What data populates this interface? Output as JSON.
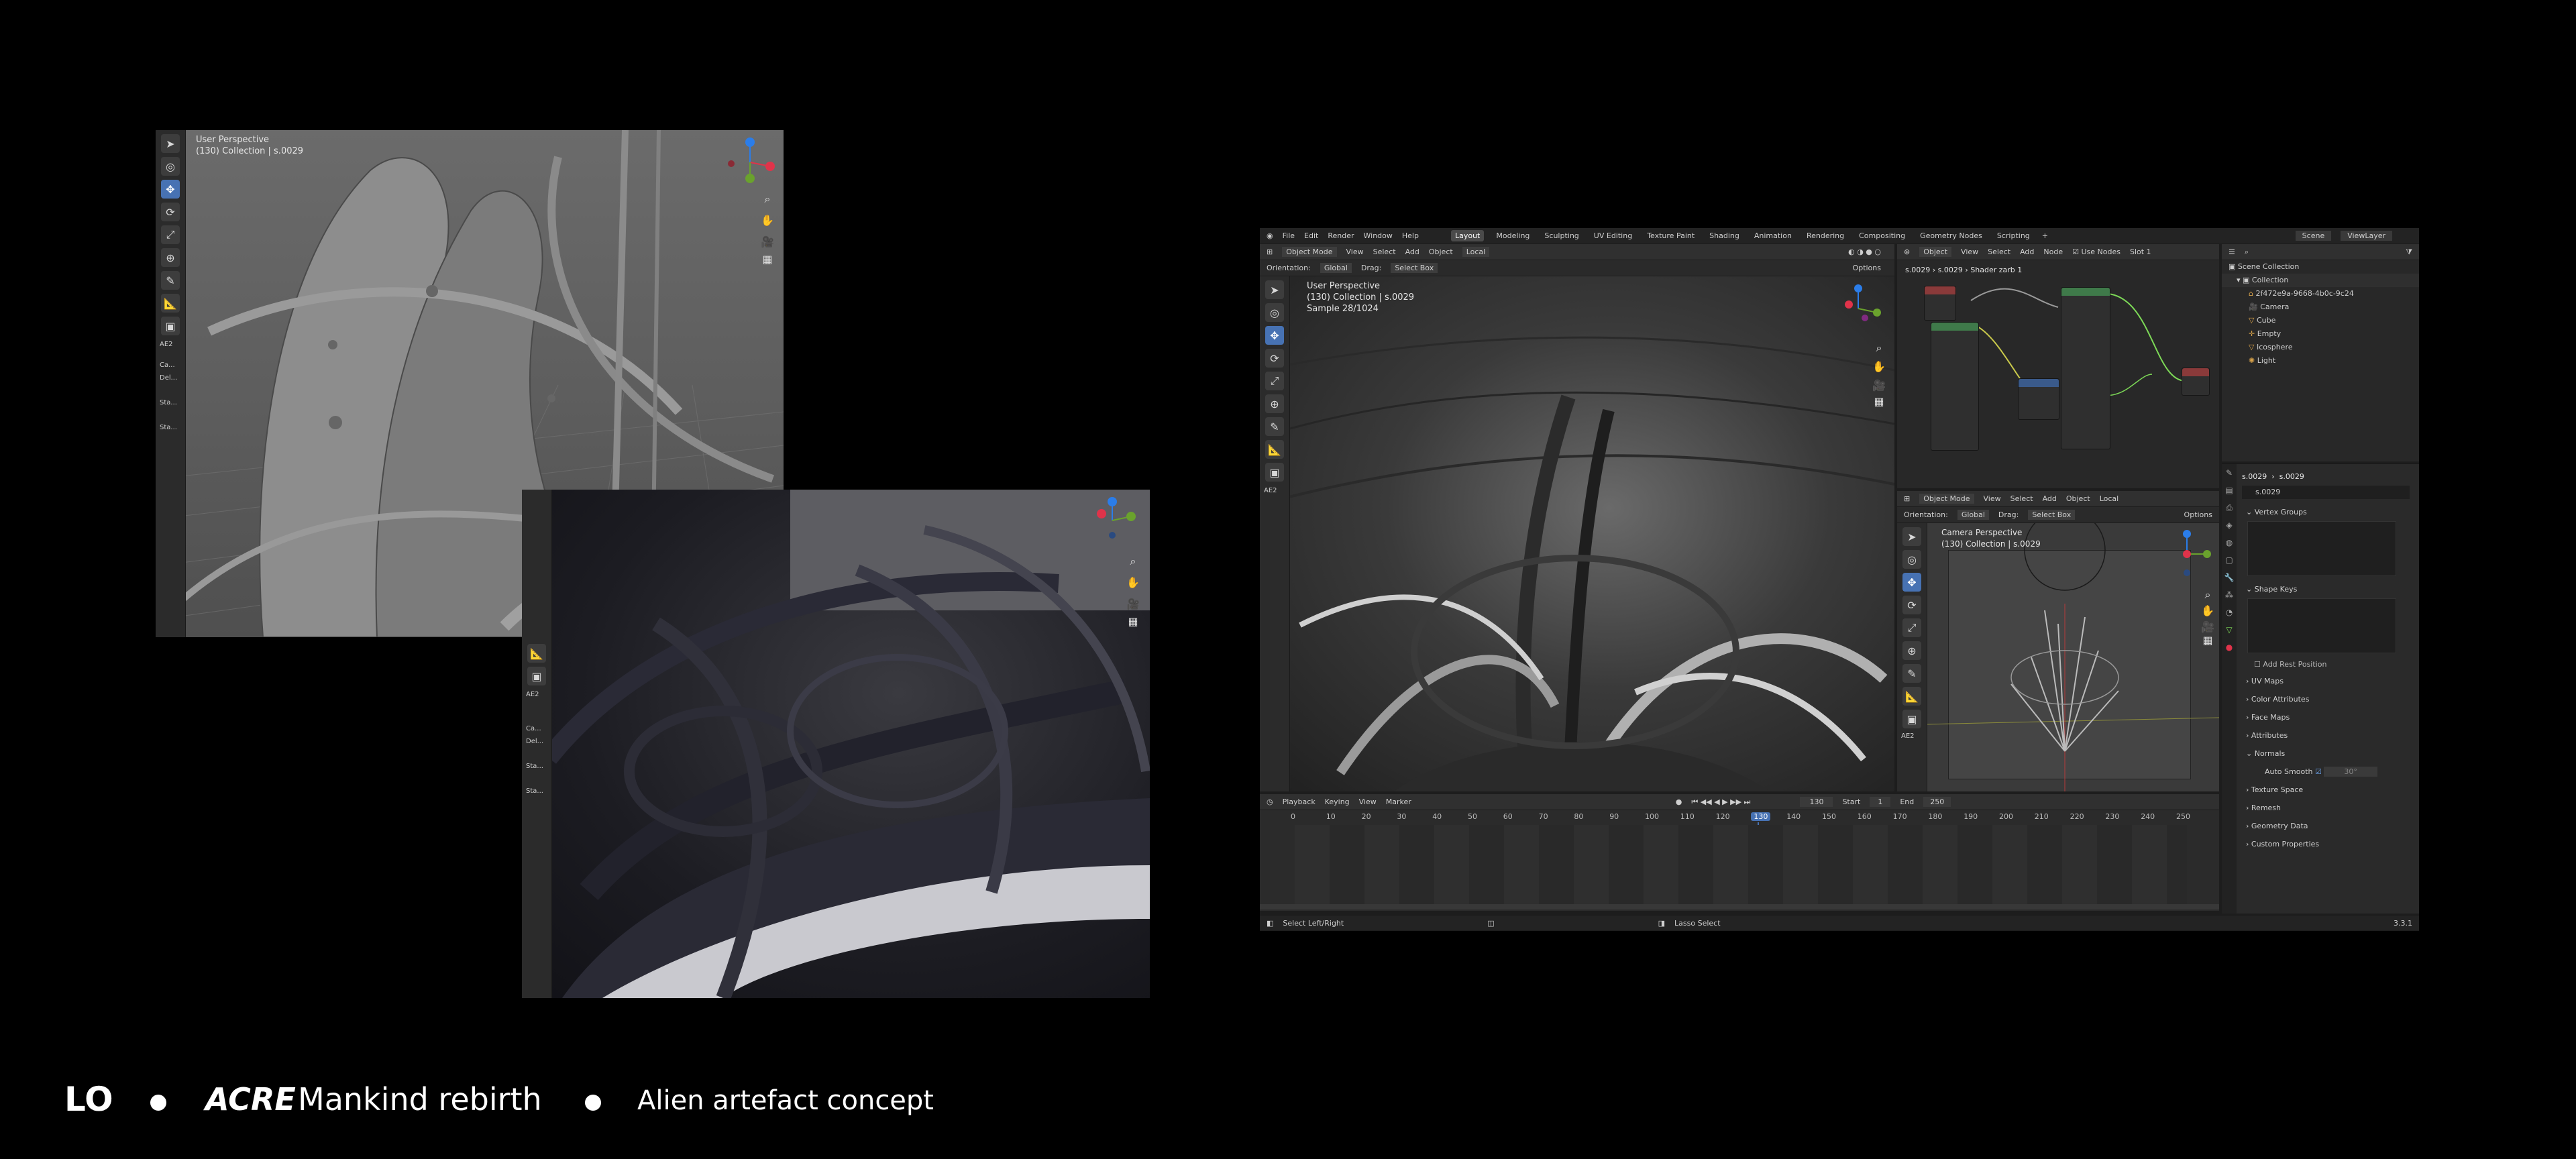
{
  "footer": {
    "logo": "LO",
    "brand": "ACRE",
    "title": "Mankind rebirth",
    "subtitle": "Alien artefact concept"
  },
  "viewport_a": {
    "line1": "User Perspective",
    "line2": "(130) Collection | s.0029",
    "panel_label": "AE2",
    "side_labels": [
      "Ca...",
      "Del...",
      "Sta...",
      "Sta..."
    ]
  },
  "viewport_b": {
    "panel_label": "AE2",
    "side_labels": [
      "Ca...",
      "Del...",
      "Sta...",
      "Sta..."
    ]
  },
  "blender": {
    "menu": [
      "File",
      "Edit",
      "Render",
      "Window",
      "Help"
    ],
    "workspaces": [
      "Layout",
      "Modeling",
      "Sculpting",
      "UV Editing",
      "Texture Paint",
      "Shading",
      "Animation",
      "Rendering",
      "Compositing",
      "Geometry Nodes",
      "Scripting"
    ],
    "active_workspace": "Layout",
    "scene": "Scene",
    "view_layer": "ViewLayer",
    "viewport_header": [
      "Object Mode",
      "View",
      "Select",
      "Add",
      "Object"
    ],
    "orientation_label": "Orientation:",
    "orientation_value": "Global",
    "drag_label": "Drag:",
    "drag_value": "Select Box",
    "pivot_value": "Local",
    "options": "Options",
    "main_vp_line1": "User Perspective",
    "main_vp_line2": "(130) Collection | s.0029",
    "main_vp_line3": "Sample 28/1024",
    "main_panel_label": "AE2",
    "node_header": [
      "Object",
      "View",
      "Select",
      "Add",
      "Node"
    ],
    "use_nodes": "Use Nodes",
    "slot": "Slot 1",
    "breadcrumb": [
      "s.0029",
      "s.0029",
      "Shader zarb 1"
    ],
    "cam_header": [
      "Object Mode",
      "View",
      "Select",
      "Add",
      "Object"
    ],
    "cam_pivot": "Local",
    "cam_orientation_label": "Orientation:",
    "cam_orientation_value": "Global",
    "cam_drag_label": "Drag:",
    "cam_drag_value": "Select Box",
    "cam_options": "Options",
    "cam_line1": "Camera Perspective",
    "cam_line2": "(130) Collection | s.0029",
    "cam_panel_label": "AE2",
    "outliner": {
      "root": "Scene Collection",
      "collection": "Collection",
      "items": [
        "2f472e9a-9668-4b0c-9c24",
        "Camera",
        "Cube",
        "Empty",
        "Icosphere",
        "Light"
      ]
    },
    "properties": {
      "crumb_left": "s.0029",
      "crumb_right": "s.0029",
      "data_name": "s.0029",
      "sections": [
        "Vertex Groups",
        "Shape Keys",
        "UV Maps",
        "Color Attributes",
        "Face Maps",
        "Attributes",
        "Normals",
        "Texture Space",
        "Remesh",
        "Geometry Data",
        "Custom Properties"
      ],
      "add_rest_position": "Add Rest Position",
      "auto_smooth": "Auto Smooth",
      "auto_smooth_value": "30°"
    },
    "timeline": {
      "menus": [
        "Playback",
        "Keying",
        "View",
        "Marker"
      ],
      "current_frame": "130",
      "start_label": "Start",
      "start_value": "1",
      "end_label": "End",
      "end_value": "250",
      "ticks": [
        "0",
        "10",
        "20",
        "30",
        "40",
        "50",
        "60",
        "70",
        "80",
        "90",
        "100",
        "110",
        "120",
        "130",
        "140",
        "150",
        "160",
        "170",
        "180",
        "190",
        "200",
        "210",
        "220",
        "230",
        "240",
        "250"
      ]
    },
    "status": {
      "left": "Select Left/Right",
      "middle": "Lasso Select",
      "version": "3.3.1"
    }
  }
}
